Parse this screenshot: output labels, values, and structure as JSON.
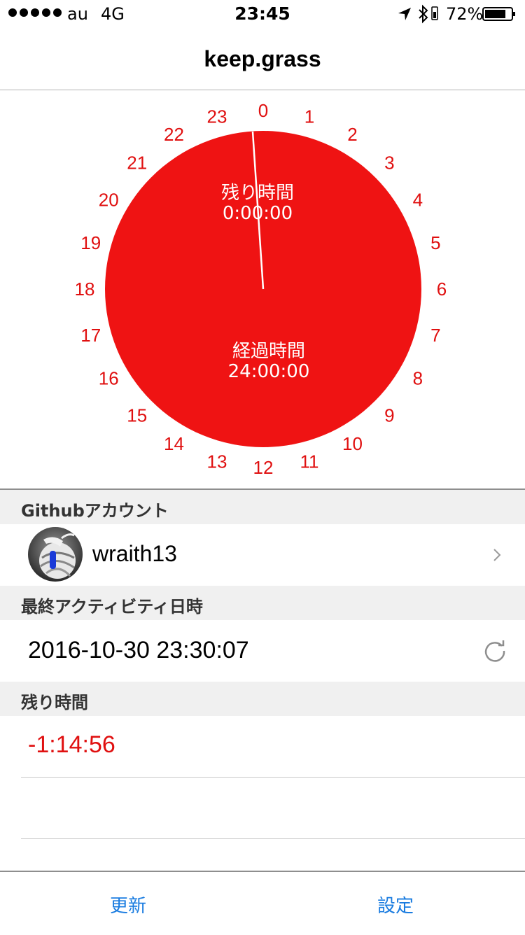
{
  "status_bar": {
    "carrier": "au",
    "network": "4G",
    "time": "23:45",
    "battery_percent": "72%",
    "icons": [
      "location-arrow-icon",
      "bluetooth-icon",
      "battery-icon"
    ]
  },
  "nav": {
    "title": "keep.grass"
  },
  "clock": {
    "hours": [
      "0",
      "1",
      "2",
      "3",
      "4",
      "5",
      "6",
      "7",
      "8",
      "9",
      "10",
      "11",
      "12",
      "13",
      "14",
      "15",
      "16",
      "17",
      "18",
      "19",
      "20",
      "21",
      "22",
      "23"
    ],
    "remaining_label": "残り時間",
    "remaining_value": "0:00:00",
    "elapsed_label": "経過時間",
    "elapsed_value": "24:00:00",
    "fill_color": "#ef1313",
    "label_color": "#e01010",
    "hand_color": "#ffffff"
  },
  "sections": {
    "account": {
      "header": "Githubアカウント",
      "username": "wraith13"
    },
    "activity": {
      "header": "最終アクティビティ日時",
      "value": "2016-10-30 23:30:07"
    },
    "remaining": {
      "header": "残り時間",
      "value": "-1:14:56"
    }
  },
  "toolbar": {
    "update_label": "更新",
    "settings_label": "設定"
  },
  "colors": {
    "accent": "#1a7ce0",
    "alert": "#e01010"
  }
}
